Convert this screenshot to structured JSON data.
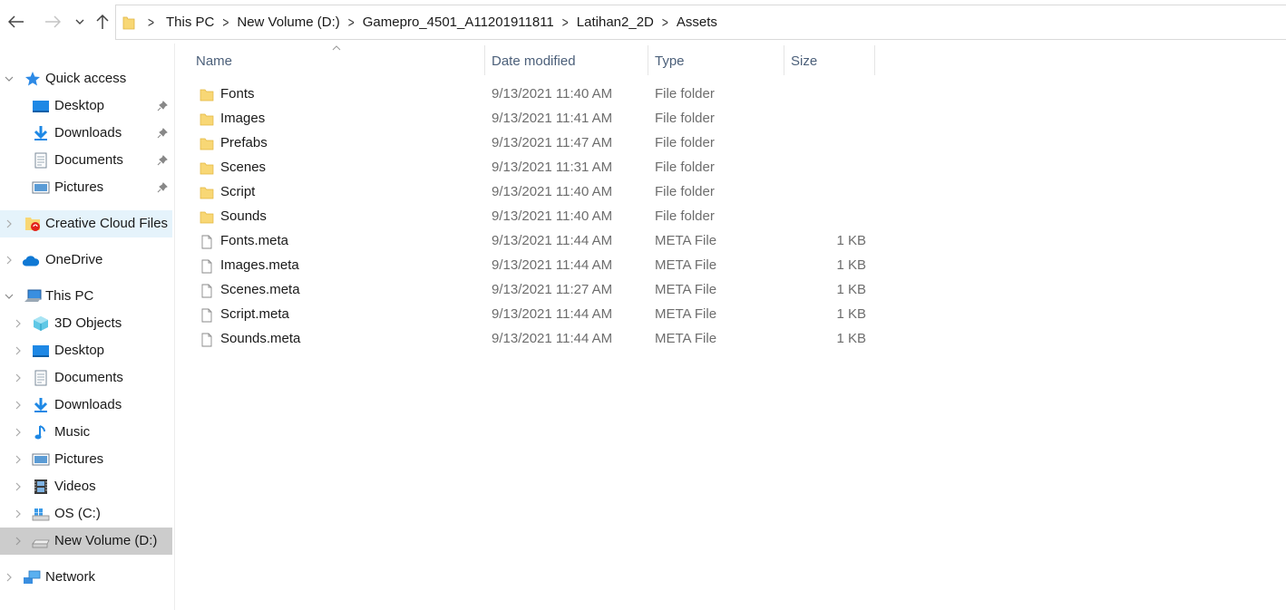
{
  "breadcrumb": [
    "This PC",
    "New Volume (D:)",
    "Gamepro_4501_A11201911811",
    "Latihan2_2D",
    "Assets"
  ],
  "columns": {
    "name": "Name",
    "date": "Date modified",
    "type": "Type",
    "size": "Size"
  },
  "sidebar": {
    "quick_access": "Quick access",
    "qa_desktop": "Desktop",
    "qa_downloads": "Downloads",
    "qa_documents": "Documents",
    "qa_pictures": "Pictures",
    "creative_cloud": "Creative Cloud Files",
    "onedrive": "OneDrive",
    "this_pc": "This PC",
    "objects_3d": "3D Objects",
    "desktop": "Desktop",
    "documents": "Documents",
    "downloads": "Downloads",
    "music": "Music",
    "pictures": "Pictures",
    "videos": "Videos",
    "os_c": "OS (C:)",
    "new_volume": "New Volume (D:)",
    "network": "Network"
  },
  "files": [
    {
      "name": "Fonts",
      "date": "9/13/2021 11:40 AM",
      "type": "File folder",
      "size": "",
      "icon": "folder-icon"
    },
    {
      "name": "Images",
      "date": "9/13/2021 11:41 AM",
      "type": "File folder",
      "size": "",
      "icon": "folder-icon"
    },
    {
      "name": "Prefabs",
      "date": "9/13/2021 11:47 AM",
      "type": "File folder",
      "size": "",
      "icon": "folder-icon"
    },
    {
      "name": "Scenes",
      "date": "9/13/2021 11:31 AM",
      "type": "File folder",
      "size": "",
      "icon": "folder-icon"
    },
    {
      "name": "Script",
      "date": "9/13/2021 11:40 AM",
      "type": "File folder",
      "size": "",
      "icon": "folder-icon"
    },
    {
      "name": "Sounds",
      "date": "9/13/2021 11:40 AM",
      "type": "File folder",
      "size": "",
      "icon": "folder-icon"
    },
    {
      "name": "Fonts.meta",
      "date": "9/13/2021 11:44 AM",
      "type": "META File",
      "size": "1 KB",
      "icon": "file-icon"
    },
    {
      "name": "Images.meta",
      "date": "9/13/2021 11:44 AM",
      "type": "META File",
      "size": "1 KB",
      "icon": "file-icon"
    },
    {
      "name": "Scenes.meta",
      "date": "9/13/2021 11:27 AM",
      "type": "META File",
      "size": "1 KB",
      "icon": "file-icon"
    },
    {
      "name": "Script.meta",
      "date": "9/13/2021 11:44 AM",
      "type": "META File",
      "size": "1 KB",
      "icon": "file-icon"
    },
    {
      "name": "Sounds.meta",
      "date": "9/13/2021 11:44 AM",
      "type": "META File",
      "size": "1 KB",
      "icon": "file-icon"
    }
  ],
  "colors": {
    "folder": "#f8d775",
    "accent_blue": "#0078d7",
    "selected_bg": "#cccccc",
    "hover_bg": "#e5f3fb",
    "header_text": "#4c607a"
  }
}
